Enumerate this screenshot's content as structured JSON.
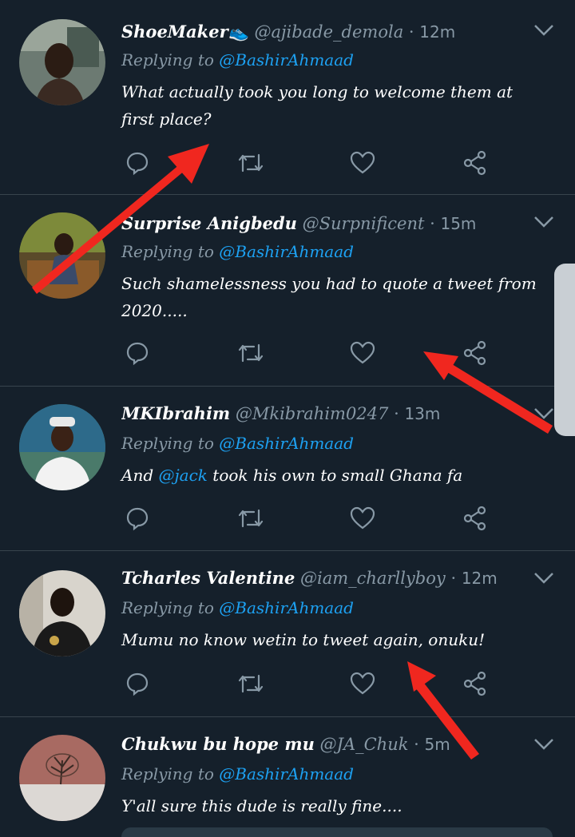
{
  "tweets": [
    {
      "name": "ShoeMaker👟",
      "handle": "@ajibade_demola",
      "time": "12m",
      "replying_prefix": "Replying to",
      "replying_to": "@BashirAhmaad",
      "text": "What actually took you long to welcome them at first place?"
    },
    {
      "name": "Surprise Anigbedu",
      "handle": "@Surpnificent",
      "time": "15m",
      "replying_prefix": "Replying to",
      "replying_to": "@BashirAhmaad",
      "text": "Such shamelessness you had to quote a tweet from 2020....."
    },
    {
      "name": "MKIbrahim",
      "handle": "@Mkibrahim0247",
      "time": "13m",
      "replying_prefix": "Replying to",
      "replying_to": "@BashirAhmaad",
      "text_before": "And ",
      "text_mention": "@jack",
      "text_after": " took his own to small Ghana fa"
    },
    {
      "name": "Tcharles Valentine",
      "handle": "@iam_charllyboy",
      "time": "12m",
      "replying_prefix": "Replying to",
      "replying_to": "@BashirAhmaad",
      "text": "Mumu no know wetin to tweet again, onuku!"
    },
    {
      "name": "Chukwu bu hope mu",
      "handle": "@JA_Chuk",
      "time": "5m",
      "replying_prefix": "Replying to",
      "replying_to": "@BashirAhmaad",
      "text": "Y'all sure this dude is really fine...."
    }
  ],
  "colors": {
    "background": "#15202b",
    "muted": "#8899a6",
    "accent": "#1da1f2",
    "annotation_arrow": "#f0271f"
  },
  "icons": [
    "reply-icon",
    "retweet-icon",
    "like-icon",
    "share-icon",
    "chevron-down-icon"
  ]
}
